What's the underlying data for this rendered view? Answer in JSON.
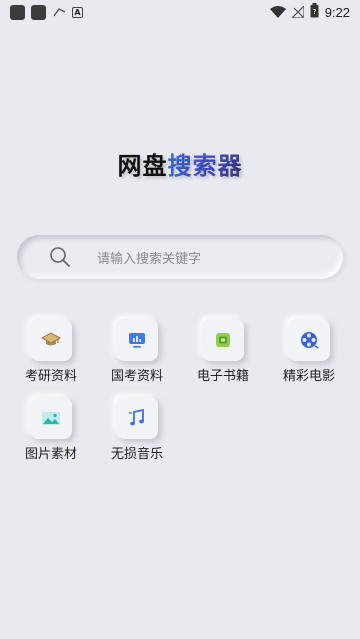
{
  "status_bar": {
    "left_icons": [
      "app-icon-1",
      "app-icon-2",
      "cast-icon",
      "font-a-icon"
    ],
    "right_icons": [
      "wifi-icon",
      "signal-off-icon",
      "battery-icon"
    ],
    "time": "9:22"
  },
  "title": {
    "part1": "网盘",
    "part2": "搜索器"
  },
  "search": {
    "placeholder": "请输入搜索关键字",
    "icon": "search-icon"
  },
  "categories": [
    {
      "label": "考研资料",
      "icon": "graduation-cap-icon",
      "color": "#c8a96a"
    },
    {
      "label": "国考资料",
      "icon": "monitor-chart-icon",
      "color": "#3a7bf2"
    },
    {
      "label": "电子书籍",
      "icon": "ebook-icon",
      "color": "#7ec33c"
    },
    {
      "label": "精彩电影",
      "icon": "film-reel-icon",
      "color": "#3a5fe0"
    },
    {
      "label": "图片素材",
      "icon": "image-icon",
      "color": "#2cc3b8"
    },
    {
      "label": "无损音乐",
      "icon": "music-note-icon",
      "color": "#3a72e8"
    }
  ]
}
